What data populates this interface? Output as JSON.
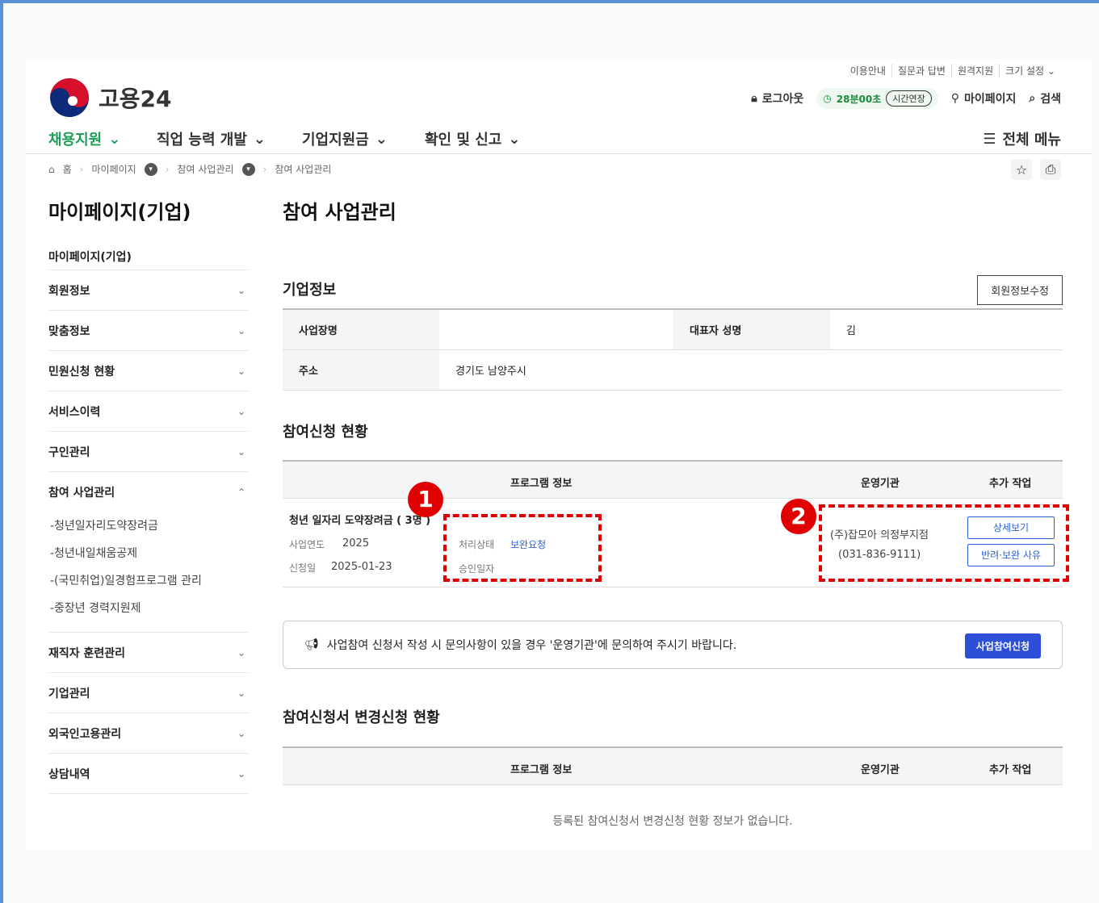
{
  "utility": [
    "이용안내",
    "질문과 답변",
    "원격지원",
    "크기 설정"
  ],
  "header": {
    "logo_text": "고용24",
    "logout": "로그아웃",
    "timer": "28분00초",
    "extend": "시간연장",
    "mypage": "마이페이지",
    "search": "검색"
  },
  "gnb": [
    "채용지원",
    "직업 능력 개발",
    "기업지원금",
    "확인 및 신고"
  ],
  "allmenu": "전체 메뉴",
  "breadcrumb": [
    "홈",
    "마이페이지",
    "참여 사업관리",
    "참여 사업관리"
  ],
  "lnb": {
    "title": "마이페이지(기업)",
    "sub": "마이페이지(기업)",
    "items_top": [
      "회원정보",
      "맞춤정보",
      "민원신청 현황",
      "서비스이력",
      "구인관리"
    ],
    "open_item": "참여 사업관리",
    "children": [
      "-청년일자리도약장려금",
      "-청년내일채움공제",
      "-(국민취업)일경험프로그램 관리",
      "-중장년 경력지원제"
    ],
    "items_bottom": [
      "재직자 훈련관리",
      "기업관리",
      "외국인고용관리",
      "상담내역"
    ]
  },
  "content": {
    "page_title": "참여 사업관리",
    "company_section": "기업정보",
    "edit_member": "회원정보수정",
    "info": {
      "biz_name_label": "사업장명",
      "biz_name": "",
      "ceo_label": "대표자 성명",
      "ceo": "김",
      "addr_label": "주소",
      "addr": "경기도 남양주시"
    },
    "apply_section": "참여신청 현황",
    "cols": {
      "program": "프로그램 정보",
      "agency": "운영기관",
      "extra": "추가 작업"
    },
    "row": {
      "program_name": "청년 일자리 도약장려금 ( 3명 )",
      "year_label": "사업연도",
      "year": "2025",
      "apply_label": "신청일",
      "apply_date": "2025-01-23",
      "status_label": "처리상태",
      "status": "보완요청",
      "approve_label": "승인일자",
      "agency": "(주)잡모아 의정부지점",
      "phone": "(031-836-9111)",
      "detail_btn": "상세보기",
      "reason_btn": "반려·보완 사유"
    },
    "notice": "사업참여 신청서 작성 시 문의사항이 있을 경우 '운영기관'에 문의하여 주시기 바랍니다.",
    "apply_btn": "사업참여신청",
    "change_section": "참여신청서 변경신청 현황",
    "empty": "등록된 참여신청서 변경신청 현황 정보가 없습니다."
  },
  "badges": [
    "1",
    "2"
  ],
  "colors": {
    "accent_green": "#1a9f55",
    "primary_blue": "#2d4fd8",
    "highlight_red": "#e00000"
  }
}
